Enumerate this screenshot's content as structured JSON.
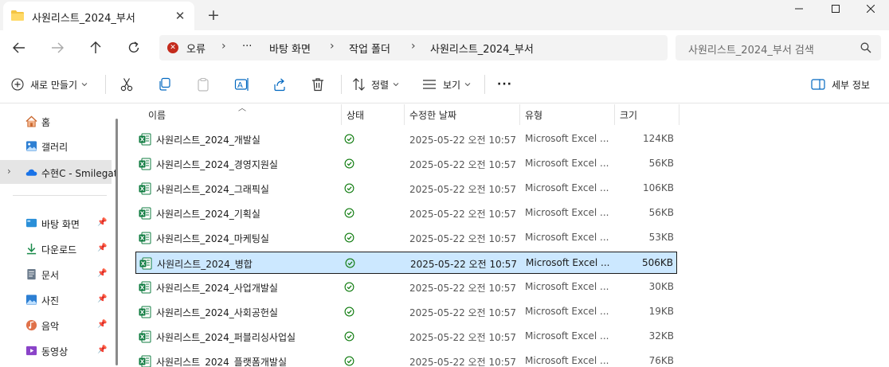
{
  "tab": {
    "title": "사원리스트_2024_부서",
    "close": "✕",
    "new": "+"
  },
  "window": {
    "minimize": "—",
    "maximize": "☐",
    "close": "✕"
  },
  "address": {
    "error_label": "오류",
    "ellipsis": "···",
    "crumbs": [
      "바탕 화면",
      "작업 폴더",
      "사원리스트_2024_부서"
    ]
  },
  "search": {
    "placeholder": "사원리스트_2024_부서 검색"
  },
  "toolbar": {
    "new_label": "새로 만들기",
    "sort_label": "정렬",
    "view_label": "보기",
    "more_label": "···",
    "details_label": "세부 정보"
  },
  "sidebar": {
    "items": [
      {
        "label": "홈",
        "icon": "home-icon",
        "pinned": false
      },
      {
        "label": "갤러리",
        "icon": "gallery-icon",
        "pinned": false
      },
      {
        "label": "수현C - Smilegat",
        "icon": "onedrive-icon",
        "pinned": false
      },
      {
        "label": "바탕 화면",
        "icon": "desktop-icon",
        "pinned": true
      },
      {
        "label": "다운로드",
        "icon": "download-icon",
        "pinned": true
      },
      {
        "label": "문서",
        "icon": "document-icon",
        "pinned": true
      },
      {
        "label": "사진",
        "icon": "pictures-icon",
        "pinned": true
      },
      {
        "label": "음악",
        "icon": "music-icon",
        "pinned": true
      },
      {
        "label": "동영상",
        "icon": "video-icon",
        "pinned": true
      }
    ],
    "pin_glyph": "📌"
  },
  "columns": [
    "이름",
    "상태",
    "수정한 날짜",
    "유형",
    "크기"
  ],
  "files": [
    {
      "name": "사원리스트_2024_개발실",
      "date": "2025-05-22 오전 10:57",
      "type": "Microsoft Excel ...",
      "size": "124KB",
      "selected": false
    },
    {
      "name": "사원리스트_2024_경영지원실",
      "date": "2025-05-22 오전 10:57",
      "type": "Microsoft Excel ...",
      "size": "56KB",
      "selected": false
    },
    {
      "name": "사원리스트_2024_그래픽실",
      "date": "2025-05-22 오전 10:57",
      "type": "Microsoft Excel ...",
      "size": "106KB",
      "selected": false
    },
    {
      "name": "사원리스트_2024_기획실",
      "date": "2025-05-22 오전 10:57",
      "type": "Microsoft Excel ...",
      "size": "56KB",
      "selected": false
    },
    {
      "name": "사원리스트_2024_마케팅실",
      "date": "2025-05-22 오전 10:57",
      "type": "Microsoft Excel ...",
      "size": "53KB",
      "selected": false
    },
    {
      "name": "사원리스트_2024_병합",
      "date": "2025-05-22 오전 10:57",
      "type": "Microsoft Excel ...",
      "size": "506KB",
      "selected": true
    },
    {
      "name": "사원리스트_2024_사업개발실",
      "date": "2025-05-22 오전 10:57",
      "type": "Microsoft Excel ...",
      "size": "30KB",
      "selected": false
    },
    {
      "name": "사원리스트_2024_사회공헌실",
      "date": "2025-05-22 오전 10:57",
      "type": "Microsoft Excel ...",
      "size": "19KB",
      "selected": false
    },
    {
      "name": "사원리스트_2024_퍼블리싱사업실",
      "date": "2025-05-22 오전 10:57",
      "type": "Microsoft Excel ...",
      "size": "32KB",
      "selected": false
    },
    {
      "name": "사원리스트_2024_플랫폼개발실",
      "date": "2025-05-22 오전 10:57",
      "type": "Microsoft Excel ...",
      "size": "76KB",
      "selected": false
    }
  ],
  "colors": {
    "accent": "#0067c0",
    "selection": "#cce8ff",
    "excel": "#107c41",
    "sync_ok": "#107c10",
    "error": "#c42b1c",
    "folder": "#f4c542"
  }
}
